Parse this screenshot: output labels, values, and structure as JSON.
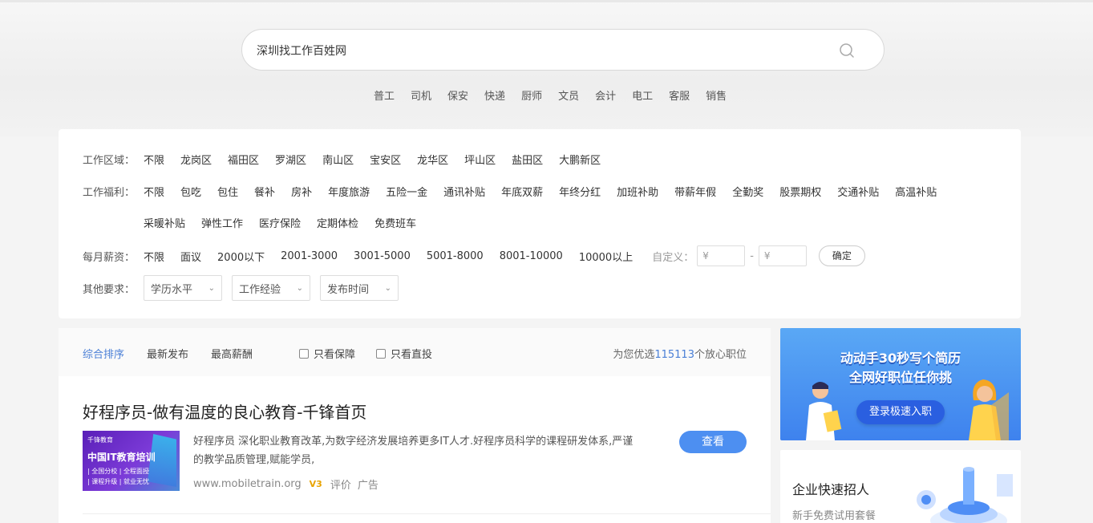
{
  "search": {
    "value": "深圳找工作百姓网"
  },
  "hot_links": [
    "普工",
    "司机",
    "保安",
    "快递",
    "厨师",
    "文员",
    "会计",
    "电工",
    "客服",
    "销售"
  ],
  "filters": {
    "area": {
      "label": "工作区域：",
      "options": [
        "不限",
        "龙岗区",
        "福田区",
        "罗湖区",
        "南山区",
        "宝安区",
        "龙华区",
        "坪山区",
        "盐田区",
        "大鹏新区"
      ]
    },
    "welfare": {
      "label": "工作福利：",
      "row1": [
        "不限",
        "包吃",
        "包住",
        "餐补",
        "房补",
        "年度旅游",
        "五险一金",
        "通讯补贴",
        "年底双薪",
        "年终分红",
        "加班补助",
        "带薪年假",
        "全勤奖",
        "股票期权",
        "交通补贴",
        "高温补贴"
      ],
      "row2": [
        "采暖补贴",
        "弹性工作",
        "医疗保险",
        "定期体检",
        "免费班车"
      ]
    },
    "salary": {
      "label": "每月薪资：",
      "options": [
        "不限",
        "面议",
        "2000以下",
        "2001-3000",
        "3001-5000",
        "5001-8000",
        "8001-10000",
        "10000以上"
      ],
      "custom_label": "自定义：",
      "min_placeholder": "¥",
      "max_placeholder": "¥",
      "dash": "-",
      "confirm": "确定"
    },
    "other": {
      "label": "其他要求：",
      "selects": [
        "学历水平",
        "工作经验",
        "发布时间"
      ]
    }
  },
  "sortbar": {
    "items": [
      "综合排序",
      "最新发布",
      "最高薪酬"
    ],
    "checks": [
      "只看保障",
      "只看直投"
    ],
    "count_prefix": "为您优选",
    "count_num": "115113",
    "count_suffix": "个放心职位"
  },
  "ad": {
    "title": "好程序员-做有温度的良心教育-千锋首页",
    "desc": "好程序员 深化职业教育改革,为数字经济发展培养更多IT人才.好程序员科学的课程研发体系,严谨的教学品质管理,赋能学员,",
    "url": "www.mobiletrain.org",
    "badge": "V3",
    "review": "评价",
    "ad_label": "广告",
    "button": "查看",
    "thumb": {
      "brand": "千锋教育",
      "headline": "中国IT教育培训",
      "line1": "| 全国分校 | 全程面授",
      "line2": "| 课程升级 | 就业无忧"
    }
  },
  "banner": {
    "line1": "动动手30秒写个简历",
    "line2": "全网好职位任你挑",
    "button": "登录极速入职"
  },
  "card2": {
    "title": "企业快速招人",
    "subtitle": "新手免费试用套餐"
  },
  "colors": {
    "accent": "#4a7fd6",
    "button": "#4d8ff1",
    "banner": "#3e82ee"
  }
}
